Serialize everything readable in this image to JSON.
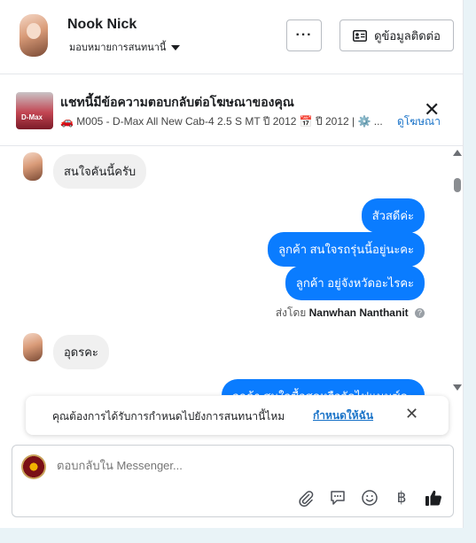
{
  "header": {
    "name": "Nook Nick",
    "assign_label": "มอบหมายการสนทนานี้",
    "more_label": "···",
    "contact_label": "ดูข้อมูลติดต่อ"
  },
  "ad": {
    "title": "แชทนี้มีข้อความตอบกลับต่อโฆษณาของคุณ",
    "subtitle": "🚗 M005 - D-Max All New Cab-4 2.5 S MT ปี 2012 📅 ปี 2012 | ⚙️ ...",
    "view_ad_label": "ดูโฆษณา",
    "close_label": "✕"
  },
  "messages": [
    {
      "from": "customer",
      "text": "สนใจคันนี้ครับ"
    },
    {
      "from": "page",
      "text": "สัวสดีค่ะ"
    },
    {
      "from": "page",
      "text": "ลูกค้า สนใจรถรุ่นนี้อยู่นะคะ"
    },
    {
      "from": "page",
      "text": "ลูกค้า อยู่จังหวัดอะไรคะ"
    },
    {
      "from": "customer",
      "text": "อุดรคะ"
    },
    {
      "from": "page",
      "text": "ลูกค้า สนใจซื้อสดหรือจัดไฟแนนซ์คะ"
    }
  ],
  "sent_by": {
    "prefix": "ส่งโดย",
    "agent": "Nanwhan Nanthanit",
    "info_icon": "?"
  },
  "notification": {
    "text": "คุณต้องการได้รับการกำหนดไปยังการสนทนานี้ไหม",
    "action_label": "กำหนดให้ฉัน",
    "close_label": "✕"
  },
  "composer": {
    "placeholder": "ตอบกลับใน Messenger...",
    "tools": [
      "attachment-icon",
      "saved-reply-icon",
      "emoji-icon",
      "baht-icon",
      "like-icon"
    ],
    "baht_symbol": "฿"
  },
  "colors": {
    "accent": "#0a7cff",
    "link": "#1a73c8",
    "incoming_bubble": "#f0f0f0"
  }
}
